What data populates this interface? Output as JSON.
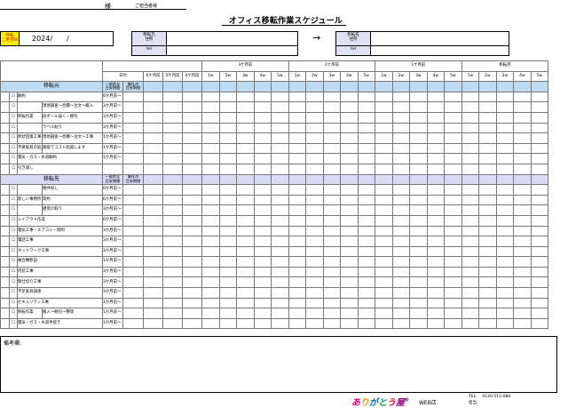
{
  "header": {
    "customer_suffix": "様",
    "contact_label": "ご担当者様",
    "title": "オフィス移転作業スケジュール"
  },
  "date_box": {
    "label_line1": "移転",
    "label_line2": "ご希望日",
    "value": "2024/　　/"
  },
  "from_box": {
    "name_label_1": "移転元",
    "name_label_2": "住所",
    "tel_label": "tel"
  },
  "to_box": {
    "name_label_1": "移転先",
    "name_label_2": "住所",
    "tel_label": "tel"
  },
  "arrow": "→",
  "schedule": {
    "day_label": "日付",
    "early_cols": [
      "6ケ月前",
      "5ケ月前",
      "4ケ月前"
    ],
    "month_groups": [
      "3ケ月前",
      "2ケ月前",
      "1ケ月前",
      "移転月"
    ],
    "weeks": [
      "1w",
      "2w",
      "3w",
      "4w",
      "5w"
    ],
    "col_general_1": "一般的な",
    "col_general_2": "目安期間",
    "col_company_1": "御社の",
    "col_company_2": "目安期間",
    "check_mark": "☐",
    "section_origin": "移転元",
    "section_destination": "移転先",
    "origin_rows": [
      {
        "cat": "解約",
        "sub": "",
        "period": "6か月前〜"
      },
      {
        "cat": "",
        "sub": "現地調査〜見積〜注文〜搬入",
        "period": "3か月前〜"
      },
      {
        "cat": "移転作業",
        "sub": "段ボール届く・梱包",
        "period": "3か月前〜"
      },
      {
        "cat": "",
        "sub": "ラベル貼り",
        "period": "3か月前〜"
      },
      {
        "cat": "原状回復工事",
        "sub": "現地調査〜見積〜注文〜工事",
        "period": "1か月前〜"
      },
      {
        "cat": "不要家具の処分",
        "sub": "買取でコスト削減します",
        "period": "1か月前〜"
      },
      {
        "cat": "電気・ガス・水道解約",
        "sub": "",
        "period": "1か月前〜"
      },
      {
        "cat": "引き渡し",
        "sub": "",
        "period": ""
      }
    ],
    "dest_rows": [
      {
        "cat": "",
        "sub": "物件探し",
        "period": "6か月前〜"
      },
      {
        "cat": "新しい事務所",
        "sub": "契約",
        "period": "6か月前〜"
      },
      {
        "cat": "",
        "sub": "鍵受け取り",
        "period": "3か月前〜"
      },
      {
        "cat": "レイアウト作成",
        "sub": "",
        "period": "6か月前〜"
      },
      {
        "cat": "電気工事・エアコン・照明",
        "sub": "",
        "period": "3か月前〜"
      },
      {
        "cat": "電話工事",
        "sub": "",
        "period": "3か月前〜"
      },
      {
        "cat": "ネットワーク工事",
        "sub": "",
        "period": "3か月前〜"
      },
      {
        "cat": "複合機移設",
        "sub": "",
        "period": "1か月前〜"
      },
      {
        "cat": "内装工事",
        "sub": "",
        "period": "3か月前〜"
      },
      {
        "cat": "間仕切り工事",
        "sub": "",
        "period": "3か月前〜"
      },
      {
        "cat": "不足家具調達",
        "sub": "",
        "period": "3か月前〜"
      },
      {
        "cat": "セキュリティ工事",
        "sub": "",
        "period": "1か月前〜"
      },
      {
        "cat": "移転作業",
        "sub": "搬入〜梱包〜整理",
        "period": "1か月前〜"
      },
      {
        "cat": "電気・ガス・水道手続き",
        "sub": "",
        "period": "1か月前〜"
      }
    ]
  },
  "notes": {
    "label": "備考欄:"
  },
  "footer": {
    "logo": "ありがとう屋",
    "logo_mark": "®",
    "store": "WEB店",
    "tel_label": "TEL:",
    "tel_value": "0120-515-080",
    "staff_label": "担当:"
  },
  "colors": {
    "date_label_bg": "#fff100",
    "section_origin_bg": "#bfdcf3",
    "section_dest_bg": "#d9dbf4",
    "location_label_bg": "#dfe1f5",
    "logo_colors": [
      "#e4007f",
      "#f39800",
      "#0068b7",
      "#009944",
      "#e60012",
      "#920783"
    ]
  }
}
